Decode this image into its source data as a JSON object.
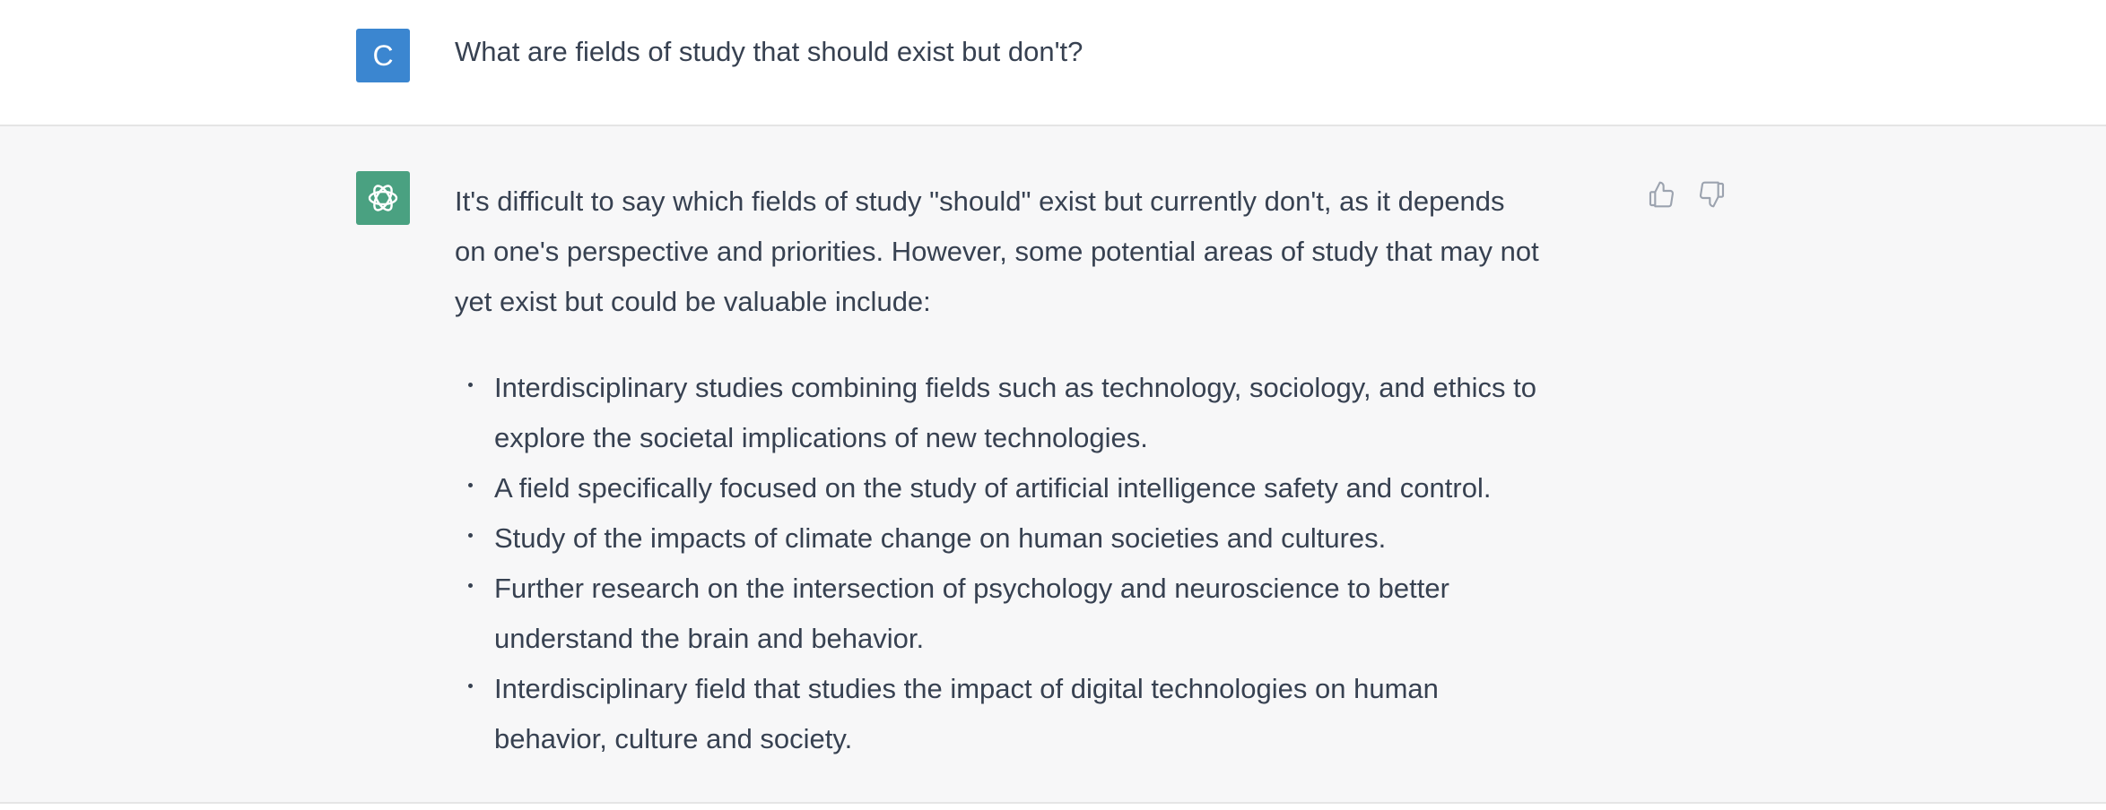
{
  "colors": {
    "user_avatar_bg": "#3b86d0",
    "assistant_avatar_bg": "#4aa181",
    "user_turn_bg": "#ffffff",
    "assistant_turn_bg": "#f7f7f8",
    "text": "#374151",
    "icon": "#9ca3af"
  },
  "user_message": {
    "avatar_letter": "C",
    "text": "What are fields of study that should exist but don't?"
  },
  "assistant_message": {
    "avatar_icon": "openai-logo-icon",
    "intro_line_1": "It's difficult to say which fields of study \"should\" exist but currently don't, as it depends",
    "intro_line_2": "on one's perspective and priorities. However, some potential areas of study that may not",
    "intro_line_3": "yet exist but could be valuable include:",
    "bullets": [
      {
        "line_1": "Interdisciplinary studies combining fields such as technology, sociology, and ethics to",
        "line_2": "explore the societal implications of new technologies."
      },
      {
        "line_1": "A field specifically focused on the study of artificial intelligence safety and control."
      },
      {
        "line_1": "Study of the impacts of climate change on human societies and cultures."
      },
      {
        "line_1": "Further research on the intersection of psychology and neuroscience to better",
        "line_2": "understand the brain and behavior."
      },
      {
        "line_1": "Interdisciplinary field that studies the impact of digital technologies on human",
        "line_2": "behavior, culture and society."
      }
    ],
    "feedback_icons": [
      "thumbs-up-icon",
      "thumbs-down-icon"
    ]
  }
}
